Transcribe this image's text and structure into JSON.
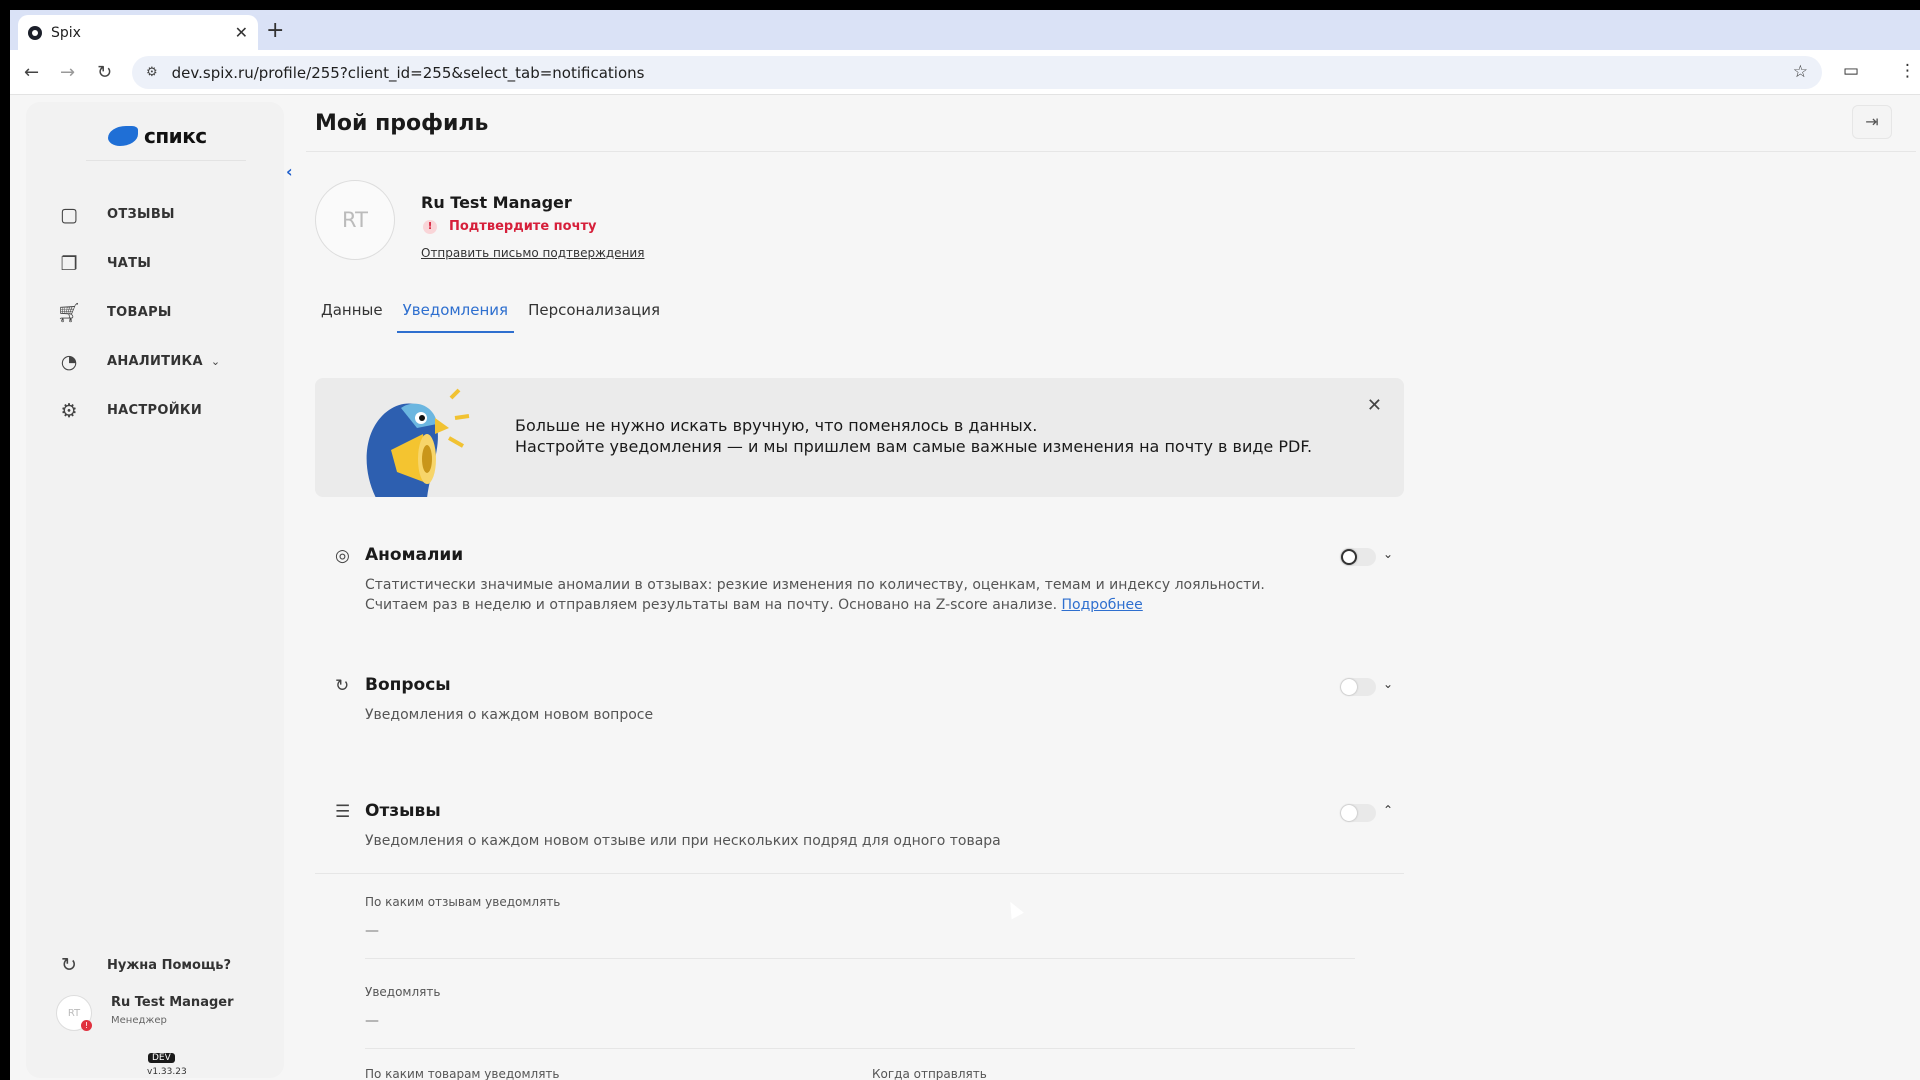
{
  "browser": {
    "tab_title": "Spix",
    "url": "dev.spix.ru/profile/255?client_id=255&select_tab=notifications"
  },
  "sidebar": {
    "brand": "спикс",
    "items": [
      {
        "label": "ОТЗЫВЫ",
        "icon": "reviews-icon"
      },
      {
        "label": "ЧАТЫ",
        "icon": "chats-icon"
      },
      {
        "label": "ТОВАРЫ",
        "icon": "cart-icon"
      },
      {
        "label": "АНАЛИТИКА",
        "icon": "pie-chart-icon"
      },
      {
        "label": "НАСТРОЙКИ",
        "icon": "gear-icon"
      }
    ],
    "help": "Нужна Помощь?",
    "user_name": "Ru Test Manager",
    "user_role": "Менеджер",
    "user_initials": "RT",
    "env_badge": "DEV",
    "version": "v1.33.23"
  },
  "profile": {
    "page_title": "Мой профиль",
    "initials": "RT",
    "name": "Ru Test Manager",
    "warning": "Подтвердите почту",
    "send_link": "Отправить письмо подтверждения"
  },
  "tabs": [
    {
      "label": "Данные"
    },
    {
      "label": "Уведомления",
      "active": true
    },
    {
      "label": "Персонализация"
    }
  ],
  "banner": {
    "line1": "Больше не нужно искать вручную, что поменялось в данных.",
    "line2": "Настройте уведомления — и мы пришлем вам самые важные изменения на почту в виде PDF."
  },
  "sections": [
    {
      "title": "Аномалии",
      "desc": "Статистически значимые аномалии в отзывах: резкие изменения по количеству, оценкам, темам и индексу лояльности. Считаем раз в неделю и отправляем результаты вам на почту. Основано на Z-score анализе.",
      "link": "Подробнее",
      "enabled": false
    },
    {
      "title": "Вопросы",
      "desc": "Уведомления о каждом новом вопросе",
      "enabled": false
    },
    {
      "title": "Отзывы",
      "desc": "Уведомления о каждом новом отзыве или при нескольких подряд для одного товара",
      "enabled": false,
      "expanded": true
    }
  ],
  "reviews_settings": {
    "which_reviews_label": "По каким отзывам уведомлять",
    "which_reviews_value": "—",
    "notify_label": "Уведомлять",
    "notify_value": "—",
    "which_products_label": "По каким товарам уведомлять",
    "when_send_label": "Когда отправлять"
  }
}
